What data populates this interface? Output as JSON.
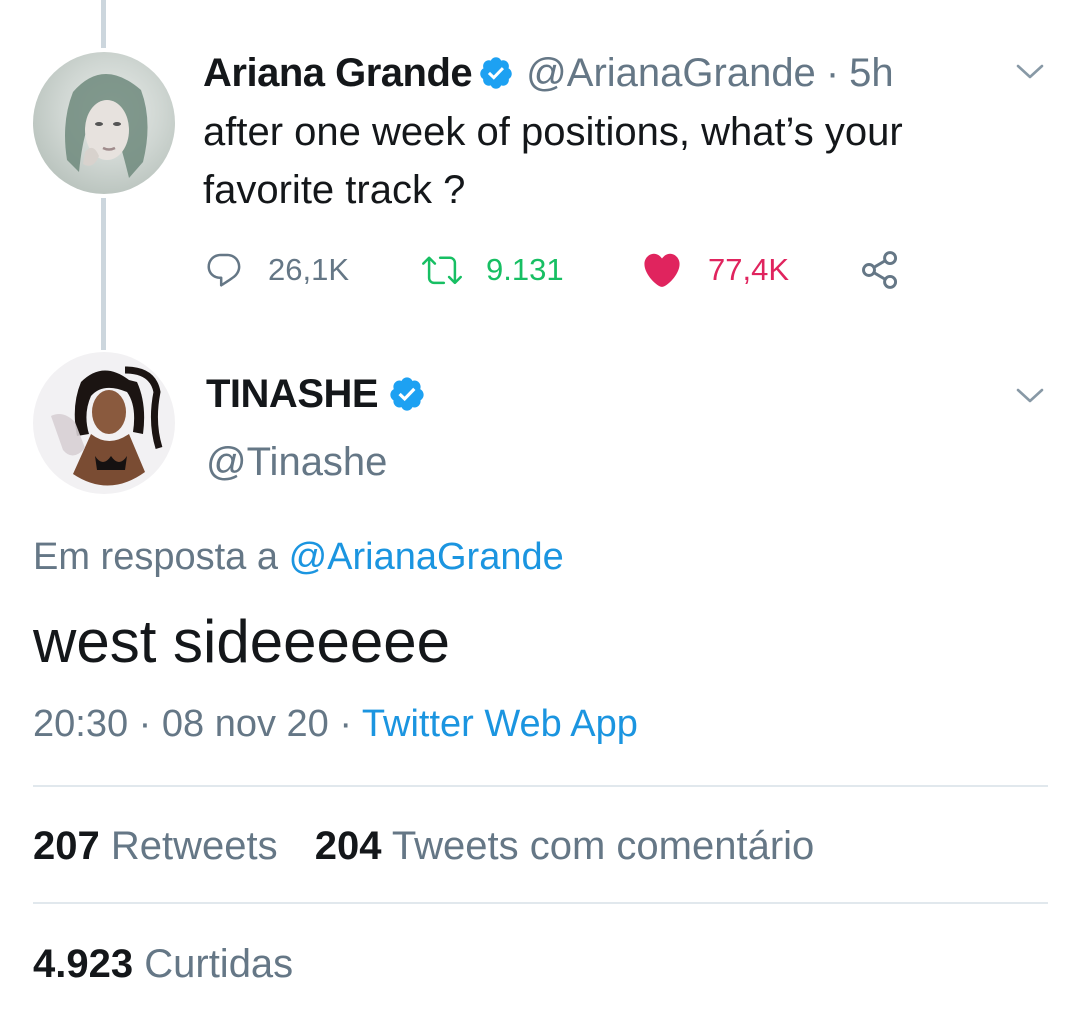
{
  "colors": {
    "text": "#14171a",
    "secondary": "#657786",
    "link": "#1b95e0",
    "retweet": "#17bf63",
    "like": "#e0245e",
    "verified": "#1da1f2",
    "divider": "#e1e8ed"
  },
  "parent_tweet": {
    "display_name": "Ariana Grande",
    "handle": "@ArianaGrande",
    "separator": "·",
    "time": "5h",
    "text_line1": "after one week of positions, what’s your",
    "text_line2": "favorite track ?",
    "replies": "26,1K",
    "retweets": "9.131",
    "likes": "77,4K",
    "icons": [
      "reply-icon",
      "retweet-icon",
      "heart-icon",
      "share-icon",
      "verified-icon",
      "chevron-down-icon"
    ]
  },
  "reply_tweet": {
    "display_name": "TINASHE",
    "handle": "@Tinashe",
    "reply_prefix": "Em resposta a",
    "reply_to": "@ArianaGrande",
    "text": "west sideeeeee",
    "time": "20:30",
    "date": "08 nov 20",
    "source": "Twitter Web App"
  },
  "stats": {
    "retweets_count": "207",
    "retweets_label": "Retweets",
    "quotes_count": "204",
    "quotes_label": "Tweets com comentário",
    "likes_count": "4.923",
    "likes_label": "Curtidas"
  }
}
